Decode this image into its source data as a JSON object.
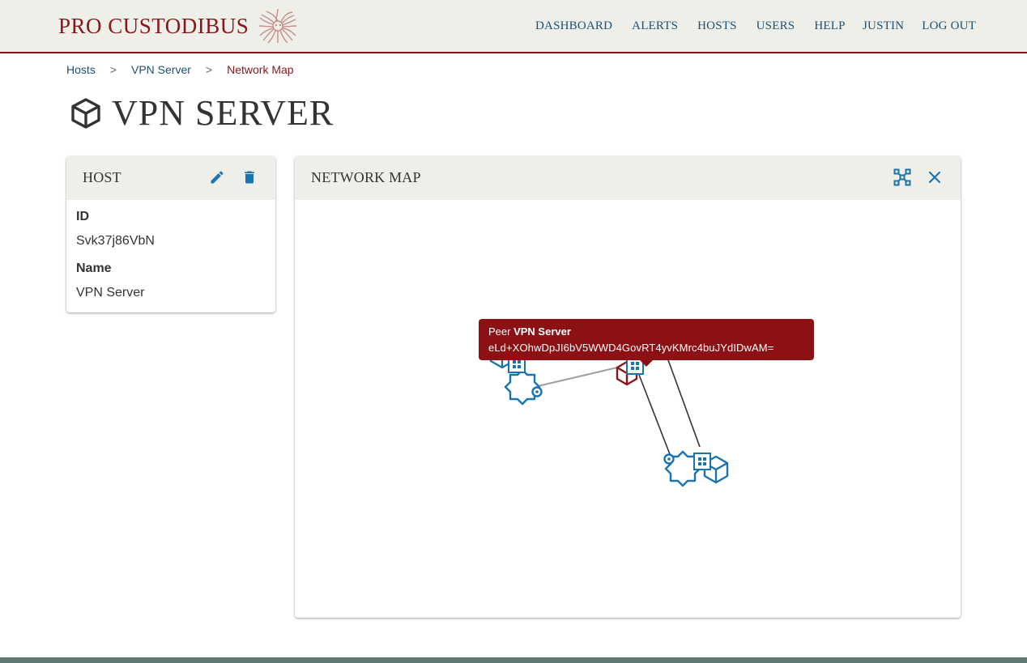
{
  "header": {
    "brand": "PRO CUSTODIBUS",
    "nav": [
      "DASHBOARD",
      "ALERTS",
      "HOSTS",
      "USERS",
      "HELP"
    ],
    "user": "JUSTIN",
    "logout": "LOG OUT"
  },
  "breadcrumb": [
    "Hosts",
    "VPN Server",
    "Network Map"
  ],
  "page": {
    "title": "VPN SERVER",
    "icon": "cube-icon"
  },
  "host_card": {
    "title": "HOST",
    "fields": [
      {
        "label": "ID",
        "value": "Svk37j86VbN"
      },
      {
        "label": "Name",
        "value": "VPN Server"
      }
    ]
  },
  "map_card": {
    "title": "NETWORK MAP",
    "tooltip": {
      "prefix": "Peer",
      "name": "VPN Server",
      "key": "eLd+XOhwDpJI6bV5WWD4GovRT4yvKMrc4buJYdIDwAM="
    }
  },
  "colors": {
    "brand": "#8b1518",
    "link": "#1c4f74",
    "node_blue": "#1a74b0",
    "node_red": "#8b1518",
    "tooltip_bg": "#8b1114"
  }
}
